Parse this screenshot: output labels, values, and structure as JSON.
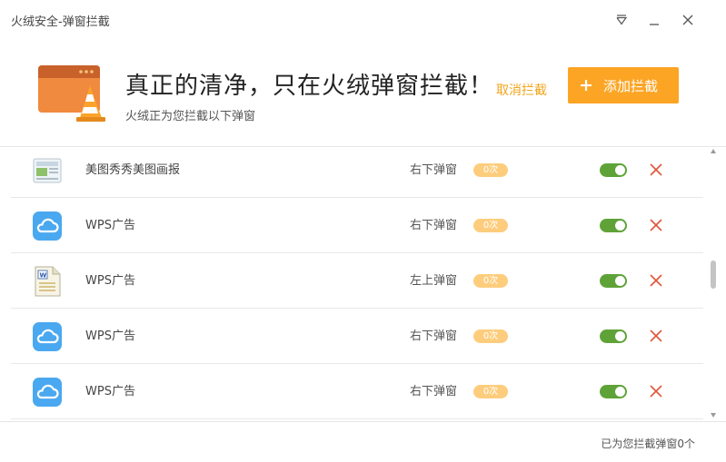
{
  "window": {
    "title": "火绒安全-弹窗拦截"
  },
  "header": {
    "headline": "真正的清净，只在火绒弹窗拦截！",
    "subline": "火绒正为您拦截以下弹窗",
    "cancel_label": "取消拦截",
    "add_label": "添加拦截"
  },
  "colors": {
    "accent": "#fca524",
    "toggle_on": "#5fa338",
    "delete": "#e0553a",
    "count_badge": "#fdcd7d",
    "cloud_icon": "#4aa8f0"
  },
  "list": {
    "rows": [
      {
        "name": "美图秀秀美图画报",
        "position": "右下弹窗",
        "count": "0次",
        "icon": "meitu-news-icon",
        "enabled": true
      },
      {
        "name": "WPS广告",
        "position": "右下弹窗",
        "count": "0次",
        "icon": "cloud-icon",
        "enabled": true
      },
      {
        "name": "WPS广告",
        "position": "左上弹窗",
        "count": "0次",
        "icon": "wps-document-icon",
        "enabled": true
      },
      {
        "name": "WPS广告",
        "position": "右下弹窗",
        "count": "0次",
        "icon": "cloud-icon",
        "enabled": true
      },
      {
        "name": "WPS广告",
        "position": "右下弹窗",
        "count": "0次",
        "icon": "cloud-icon",
        "enabled": true
      }
    ]
  },
  "footer": {
    "summary": "已为您拦截弹窗0个"
  }
}
